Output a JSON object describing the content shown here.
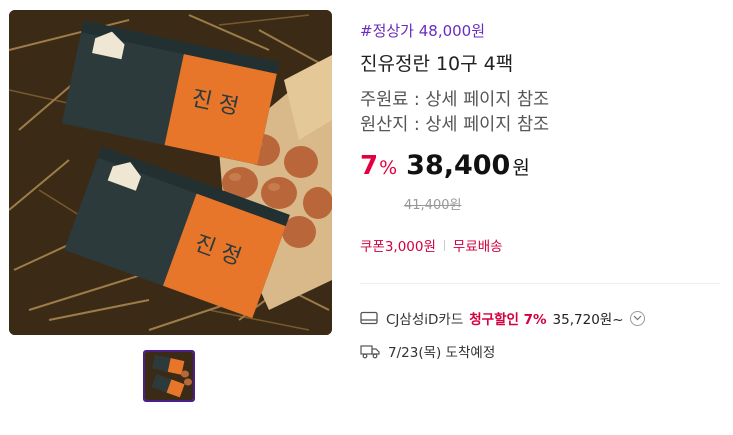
{
  "product": {
    "tag": "#정상가 48,000원",
    "title": "진유정란 10구 4팩",
    "spec_ingredient": "주원료 : 상세 페이지 참조",
    "spec_origin": "원산지 : 상세 페이지 참조"
  },
  "price": {
    "discount_rate": "7",
    "discount_unit": "%",
    "sale_price": "38,400",
    "currency": "원",
    "original_price": "41,400원"
  },
  "badges": {
    "coupon": "쿠폰3,000원",
    "shipping": "무료배송"
  },
  "card_benefit": {
    "card_name": "CJ삼성iD카드",
    "discount_label": "청구할인 7%",
    "amount": "35,720원~",
    "icon": "credit-card-icon"
  },
  "delivery": {
    "text": "7/23(목) 도착예정",
    "icon": "truck-icon"
  },
  "images": {
    "main_alt_icon": "product-photo",
    "thumbnail_count": 1
  },
  "colors": {
    "accent_purple": "#6a2bbf",
    "discount_red": "#e4003f",
    "box_orange": "#e8762a",
    "box_dark": "#2d3a3b"
  }
}
